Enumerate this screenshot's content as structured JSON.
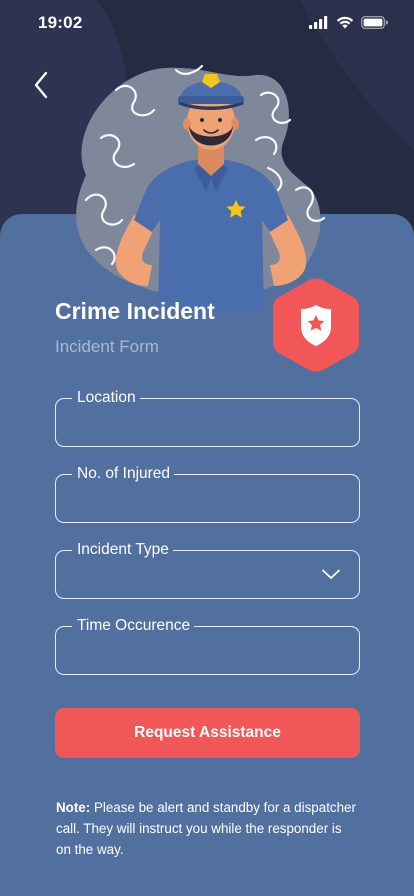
{
  "status_bar": {
    "time": "19:02",
    "icons": [
      "signal-icon",
      "wifi-icon",
      "battery-icon"
    ]
  },
  "nav": {
    "back_icon": "chevron-left-icon"
  },
  "header": {
    "title": "Crime Incident",
    "subtitle": "Incident Form",
    "badge_icon": "police-shield-star-icon"
  },
  "form": {
    "fields": [
      {
        "label": "Location",
        "value": ""
      },
      {
        "label": "No. of Injured",
        "value": ""
      },
      {
        "label": "Incident Type",
        "value": "",
        "icon": "chevron-down-icon"
      },
      {
        "label": "Time Occurence",
        "value": ""
      }
    ],
    "submit_label": "Request Assistance"
  },
  "note": {
    "prefix": "Note:",
    "text": " Please be alert and standby for a dispatcher call. They will instruct you while the responder is on the way."
  },
  "colors": {
    "background_dark": "#262b44",
    "card": "#52709f",
    "accent_red": "#f05756",
    "subtitle": "#a9b9d6"
  }
}
